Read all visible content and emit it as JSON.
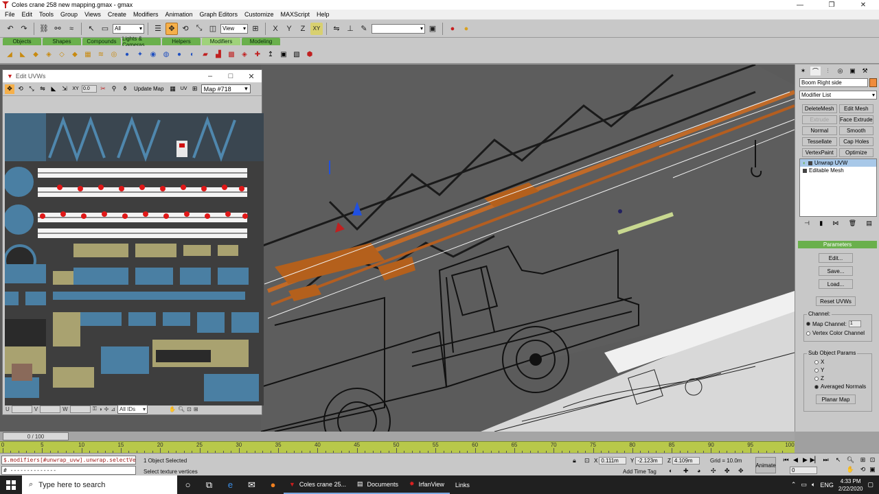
{
  "window": {
    "title": "Coles crane 258 new mapping.gmax - gmax",
    "min": "—",
    "max": "❐",
    "close": "✕"
  },
  "menu": [
    "File",
    "Edit",
    "Tools",
    "Group",
    "Views",
    "Create",
    "Modifiers",
    "Animation",
    "Graph Editors",
    "Customize",
    "MAXScript",
    "Help"
  ],
  "toolbar": {
    "filter": "All",
    "refcoord": "View",
    "axis_xy": "XY"
  },
  "tabs": [
    "Objects",
    "Shapes",
    "Compounds",
    "Lights & Cameras",
    "Helpers",
    "Modifiers",
    "Modeling"
  ],
  "active_tab": "Modifiers",
  "uv_editor": {
    "title": "Edit UVWs",
    "spin_value": "0.0",
    "update_map": "Update Map",
    "uv_label": "UV",
    "map": "Map #718",
    "u_label": "U",
    "v_label": "V",
    "w_label": "W",
    "ids": "All IDs"
  },
  "command_panel": {
    "object_name": "Boom Right side",
    "modifier_list": "Modifier List",
    "buttons": [
      "DeleteMesh",
      "Edit Mesh",
      "Extrude",
      "Face Extrude",
      "Normal",
      "Smooth",
      "Tessellate",
      "Cap Holes",
      "VertexPaint",
      "Optimize"
    ],
    "stack": [
      "Unwrap UVW",
      "Editable Mesh"
    ],
    "rollout": "Parameters",
    "edit": "Edit...",
    "save": "Save...",
    "load": "Load...",
    "reset": "Reset UVWs",
    "channel_group": "Channel:",
    "map_channel": "Map Channel:",
    "map_channel_value": "1",
    "vertex_color": "Vertex Color Channel",
    "subobj_group": "Sub Object Params",
    "x": "X",
    "y": "Y",
    "z": "Z",
    "avg_normals": "Averaged Normals",
    "planar": "Planar Map"
  },
  "timeline": {
    "frame": "0 / 100",
    "ticks": [
      "0",
      "5",
      "10",
      "15",
      "20",
      "25",
      "30",
      "35",
      "40",
      "45",
      "50",
      "55",
      "60",
      "65",
      "70",
      "75",
      "80",
      "85",
      "90",
      "95",
      "100"
    ]
  },
  "status": {
    "mxs": "$.modifiers[#unwrap_uvw].unwrap.selectVert",
    "mxs2": "# --------------",
    "selected": "1 Object Selected",
    "prompt": "Select texture vertices",
    "x_label": "X",
    "x": "0.111m",
    "y_label": "Y",
    "y": "-2.123m",
    "z_label": "Z",
    "z": "4.109m",
    "grid": "Grid = 10.0m",
    "add_time_tag": "Add Time Tag",
    "animate": "Animate",
    "frame_field": "0"
  },
  "taskbar": {
    "search": "Type here to search",
    "apps": [
      "Coles crane 25...",
      "Documents",
      "IrfanView",
      "Links"
    ],
    "lang": "ENG",
    "time": "4:33 PM",
    "date": "2/22/2020"
  },
  "colors": {
    "accent": "#f6b04a",
    "tab_green": "#6ab04c",
    "viewport_bg": "#5b5b5b",
    "boom_orange": "#c06a28",
    "track": "#b8c84a"
  }
}
